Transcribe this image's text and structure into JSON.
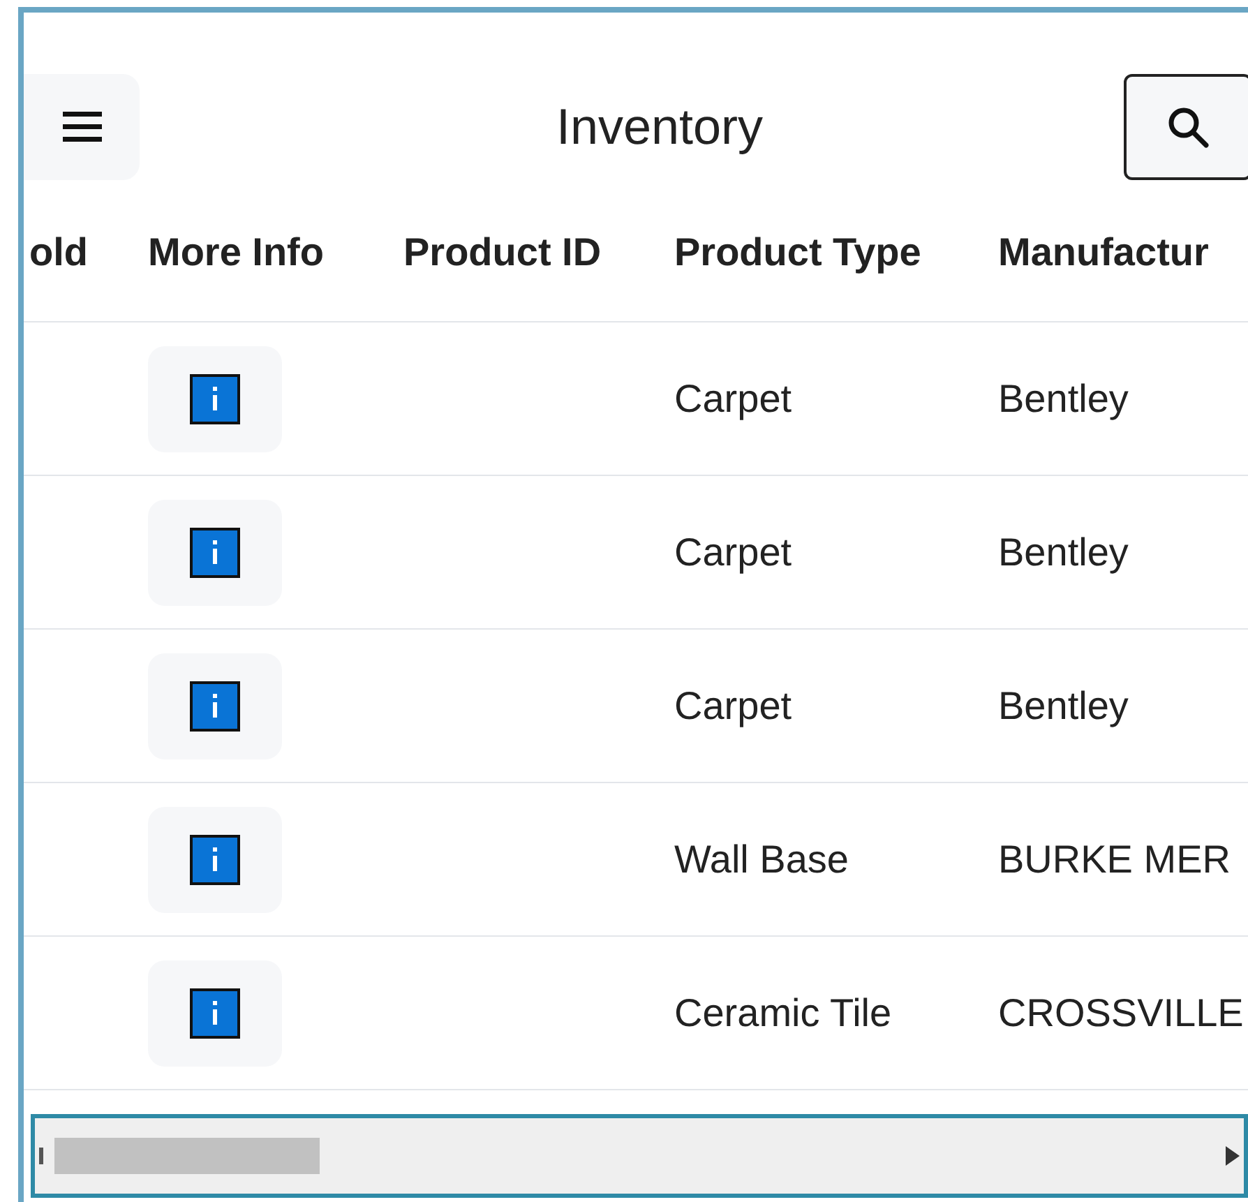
{
  "header": {
    "title": "Inventory"
  },
  "table": {
    "columns": [
      "old",
      "More Info",
      "Product ID",
      "Product Type",
      "Manufactur"
    ],
    "rows": [
      {
        "product_type": "Carpet",
        "manufacturer": "Bentley"
      },
      {
        "product_type": "Carpet",
        "manufacturer": "Bentley"
      },
      {
        "product_type": "Carpet",
        "manufacturer": "Bentley"
      },
      {
        "product_type": "Wall Base",
        "manufacturer": "BURKE MER"
      },
      {
        "product_type": "Ceramic Tile",
        "manufacturer": "CROSSVILLE"
      }
    ]
  }
}
